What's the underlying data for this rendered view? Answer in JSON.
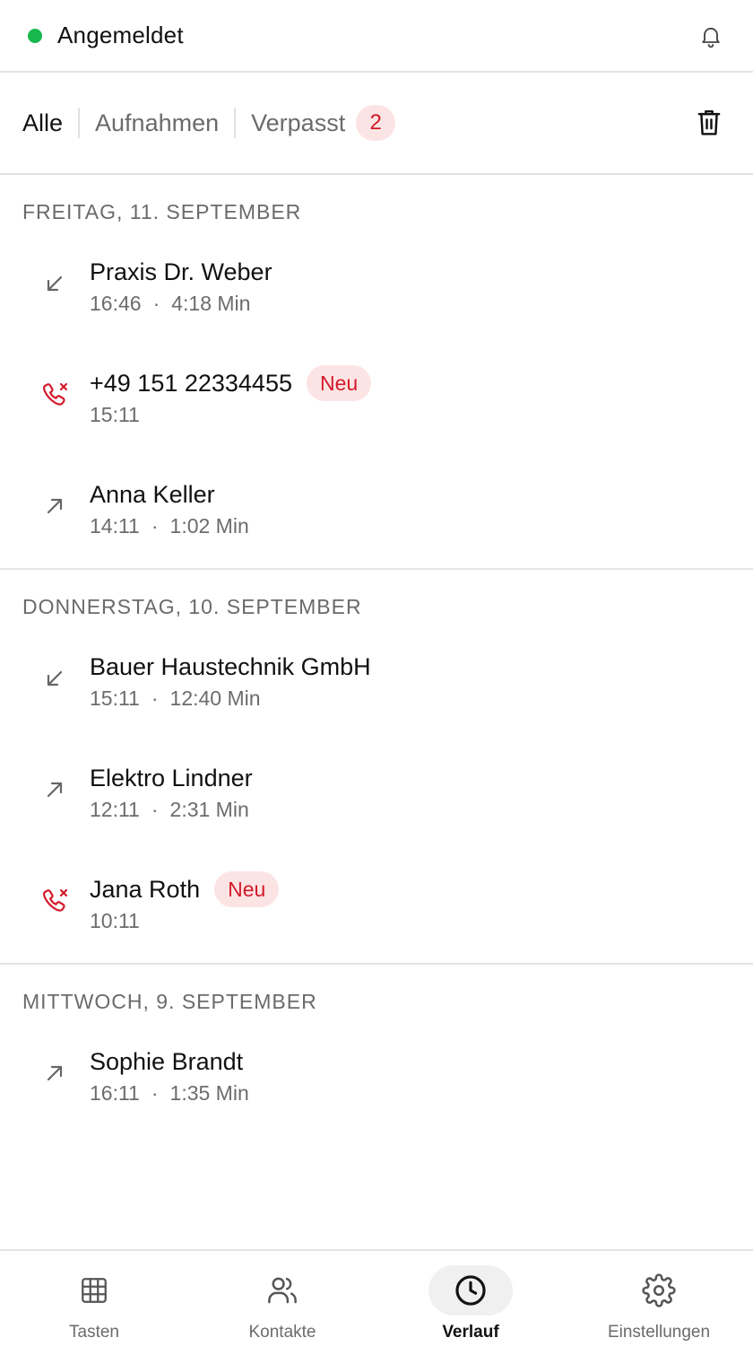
{
  "header": {
    "status_text": "Angemeldet",
    "status_color": "#16b84e",
    "bell_icon": "bell-icon"
  },
  "tabs": {
    "all_label": "Alle",
    "recordings_label": "Aufnahmen",
    "missed_label": "Verpasst",
    "missed_count": "2",
    "trash_icon": "trash-icon"
  },
  "sections": [
    {
      "date": "FREITAG, 11. SEPTEMBER",
      "calls": [
        {
          "name": "Praxis Dr. Weber",
          "time": "16:46",
          "duration": "4:18 Min",
          "type": "incoming"
        },
        {
          "name": "+49 151 22334455",
          "time": "15:11",
          "duration": "",
          "type": "missed",
          "badge": "Neu"
        },
        {
          "name": "Anna Keller",
          "time": "14:11",
          "duration": "1:02 Min",
          "type": "outgoing"
        }
      ]
    },
    {
      "date": "DONNERSTAG, 10. SEPTEMBER",
      "calls": [
        {
          "name": "Bauer Haustechnik GmbH",
          "time": "15:11",
          "duration": "12:40 Min",
          "type": "incoming"
        },
        {
          "name": "Elektro Lindner",
          "time": "12:11",
          "duration": "2:31 Min",
          "type": "outgoing"
        },
        {
          "name": "Jana Roth",
          "time": "10:11",
          "duration": "",
          "type": "missed",
          "badge": "Neu"
        }
      ]
    },
    {
      "date": "MITTWOCH, 9. SEPTEMBER",
      "calls": [
        {
          "name": "Sophie Brandt",
          "time": "16:11",
          "duration": "1:35 Min",
          "type": "outgoing"
        }
      ]
    }
  ],
  "separator": "·",
  "nav": {
    "keypad_label": "Tasten",
    "contacts_label": "Kontakte",
    "history_label": "Verlauf",
    "settings_label": "Einstellungen"
  },
  "colors": {
    "accent_red": "#d21a2a",
    "badge_bg": "#fde4e4",
    "muted_text": "#6b6b6b"
  }
}
